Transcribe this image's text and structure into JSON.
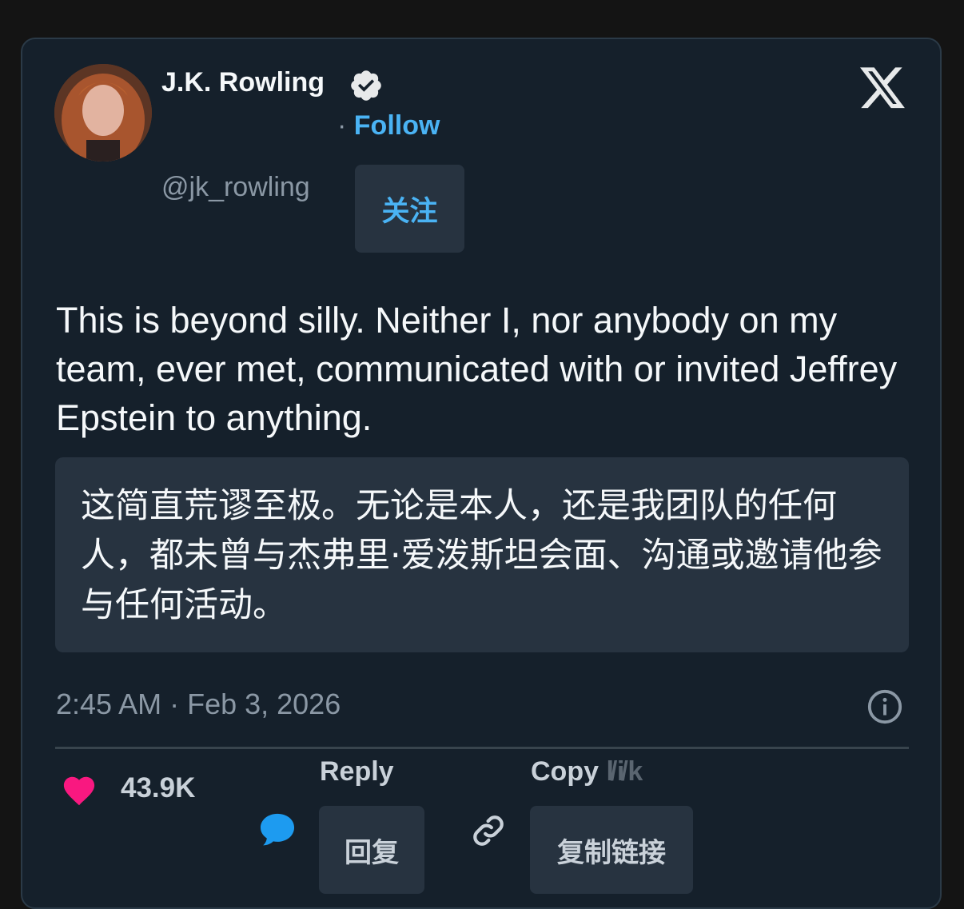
{
  "author": {
    "name": "J.K. Rowling",
    "handle": "@jk_rowling",
    "follow_separator": "·",
    "follow_label": "Follow",
    "follow_translation": "关注"
  },
  "tweet": {
    "text": "This is beyond silly. Neither I, nor anybody on my team, ever met, communicated with or invited Jeffrey Epstein to anything.",
    "translation": "这简直荒谬至极。无论是本人，还是我团队的任何人，都未曾与杰弗里·爱泼斯坦会面、沟通或邀请他参与任何活动。",
    "timestamp": "2:45 AM · Feb 3, 2026"
  },
  "actions": {
    "likes_count": "43.9K",
    "reply_label": "Reply",
    "reply_translation": "回复",
    "copy_label": "Copy",
    "copy_label_obscured": "l̸i̸k",
    "copy_translation": "复制链接"
  },
  "icons": {
    "verified": "verified-badge-icon",
    "brand": "x-logo-icon",
    "info": "info-icon",
    "like": "heart-icon",
    "reply": "speech-bubble-icon",
    "copy": "link-icon"
  },
  "colors": {
    "background": "#15202b",
    "accent": "#4ab3f4",
    "heart": "#f91880",
    "reply_icon": "#1d9bf0"
  }
}
